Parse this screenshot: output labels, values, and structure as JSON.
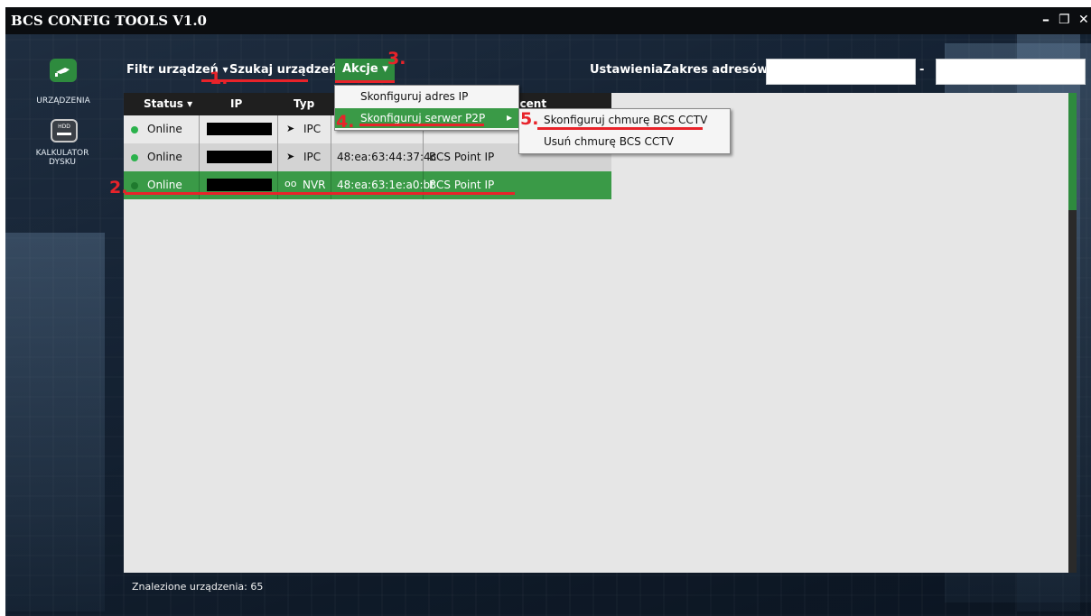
{
  "window": {
    "title": "BCS CONFIG TOOLS V1.0",
    "minimize": "–",
    "restore": "❐",
    "close": "✕"
  },
  "sidebar": [
    {
      "label": "URZĄDZENIA",
      "icon": "camera-icon"
    },
    {
      "label_line1": "KALKULATOR",
      "label_line2": "DYSKU",
      "icon": "hdd-icon",
      "icon_text": "HDD"
    }
  ],
  "toolbar": {
    "filter": "Filtr urządzeń",
    "filter_caret": "▾",
    "search": "Szukaj urządzeń",
    "actions": "Akcje ▾",
    "settings": "Ustawienia",
    "range_label": "Zakres adresów:",
    "range_sep": "-",
    "range_from": "",
    "range_to": ""
  },
  "table": {
    "headers": [
      "Status ▾",
      "IP",
      "Typ",
      "ucent"
    ],
    "rows": [
      {
        "status": "Online",
        "type": "IPC",
        "mac": "",
        "producer": ""
      },
      {
        "status": "Online",
        "type": "IPC",
        "mac": "48:ea:63:44:37:4c",
        "producer": "BCS Point IP"
      },
      {
        "status": "Online",
        "type": "NVR",
        "mac": "48:ea:63:1e:a0:bf",
        "producer": "BCS Point IP"
      }
    ]
  },
  "menu": {
    "items": [
      "Skonfiguruj adres IP",
      "Skonfiguruj serwer P2P"
    ],
    "submenu_arrow": "▸",
    "submenu": [
      "Skonfiguruj chmurę BCS CCTV",
      "Usuń chmurę BCS CCTV"
    ]
  },
  "annotations": [
    "1.",
    "2.",
    "3.",
    "4.",
    "5."
  ],
  "status_bar": "Znalezione urządzenia: 65",
  "colors": {
    "accent_green": "#2e8b3e",
    "highlight_red": "#e8232a",
    "online_dot": "#2bb24c",
    "titlebar": "#0b0d10"
  }
}
